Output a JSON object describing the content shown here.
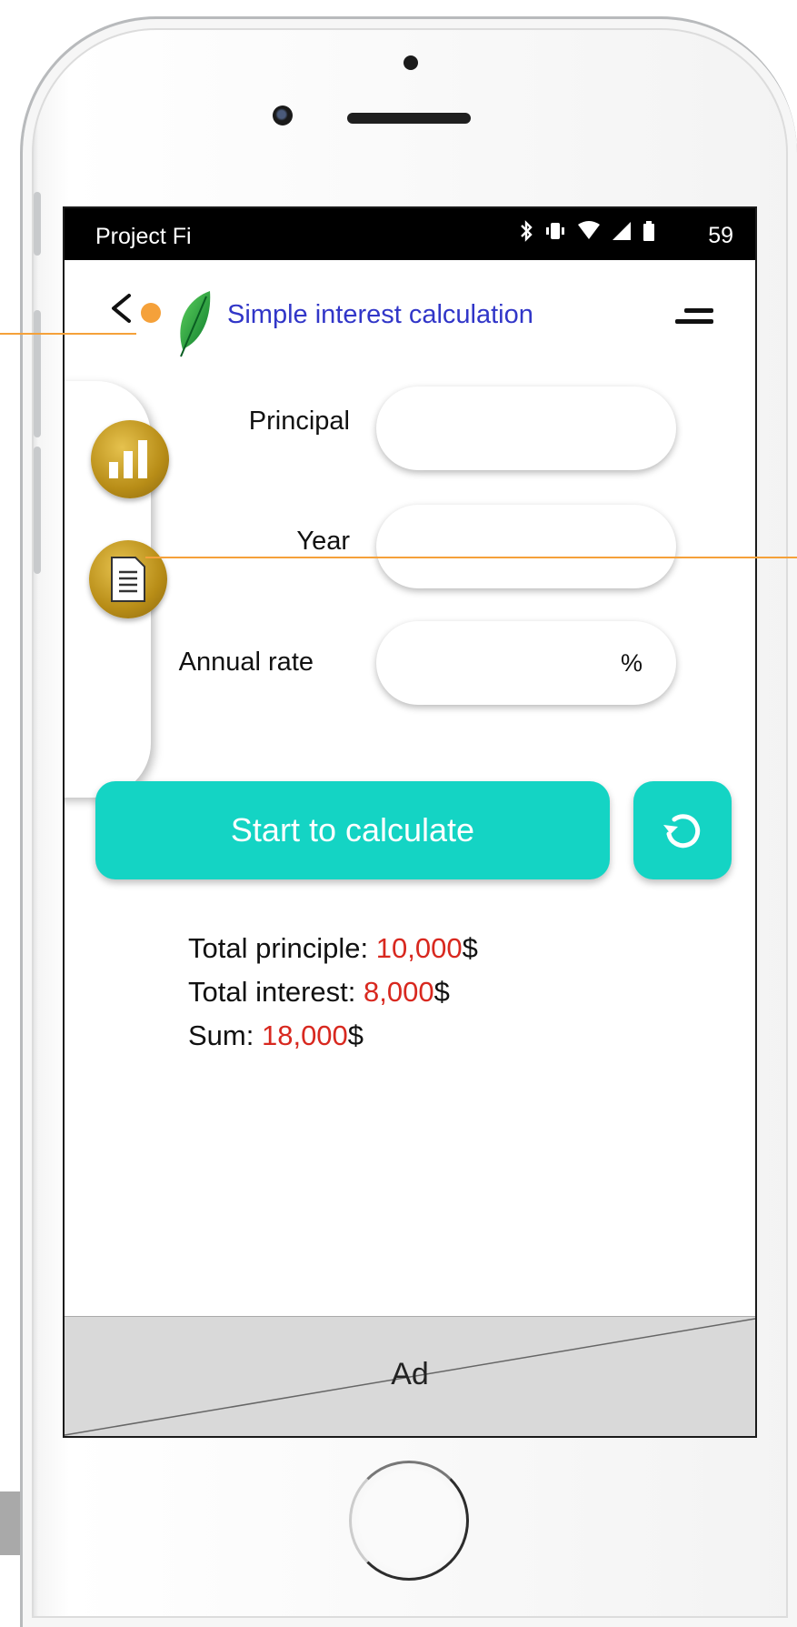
{
  "status_bar": {
    "carrier": "Project Fi",
    "time": "59"
  },
  "header": {
    "title": "Simple interest calculation"
  },
  "form": {
    "principal_label": "Principal",
    "principal_value": "",
    "year_label": "Year",
    "year_value": "",
    "rate_label": "Annual rate",
    "rate_value": "",
    "rate_unit": "%"
  },
  "actions": {
    "calculate_label": "Start to calculate"
  },
  "results": {
    "principal_label": "Total principle: ",
    "principal_value": "10,000",
    "interest_label": "Total interest: ",
    "interest_value": "8,000",
    "sum_label": "Sum: ",
    "sum_value": "18,000",
    "currency": "$"
  },
  "ad": {
    "label": "Ad"
  },
  "colors": {
    "accent": "#14d4c4",
    "title": "#3136c8",
    "result_value": "#d8281f",
    "gold": "#c99b1c",
    "annotation": "#f5a13a"
  }
}
